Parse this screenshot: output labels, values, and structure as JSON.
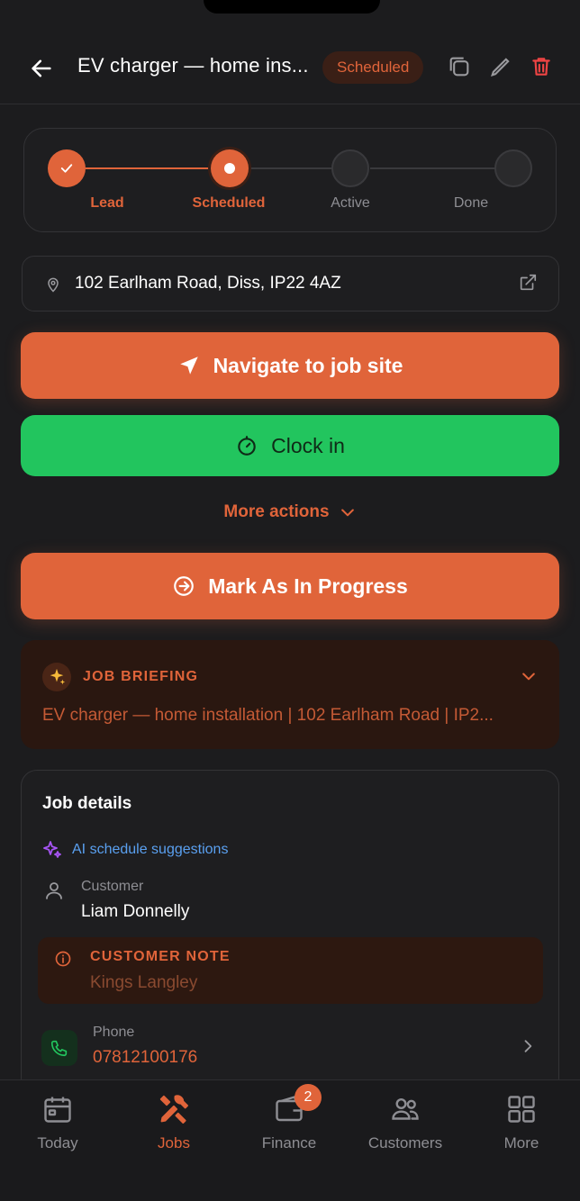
{
  "header": {
    "title": "EV charger — home ins...",
    "status": "Scheduled"
  },
  "progress": {
    "steps": [
      {
        "label": "Lead"
      },
      {
        "label": "Scheduled"
      },
      {
        "label": "Active"
      },
      {
        "label": "Done"
      }
    ]
  },
  "address": {
    "text": "102 Earlham Road, Diss, IP22 4AZ"
  },
  "actions": {
    "navigate_label": "Navigate to job site",
    "clock_in_label": "Clock in",
    "more_actions_label": "More actions",
    "mark_progress_label": "Mark As In Progress"
  },
  "briefing": {
    "title": "JOB BRIEFING",
    "text": "EV charger — home installation | 102 Earlham Road | IP2..."
  },
  "details": {
    "title": "Job details",
    "ai_link": "AI schedule suggestions",
    "customer_label": "Customer",
    "customer_name": "Liam Donnelly",
    "note_title": "CUSTOMER NOTE",
    "note_text": "Kings Langley",
    "phone_label": "Phone",
    "phone_number": "07812100176"
  },
  "tabbar": {
    "tabs": [
      {
        "label": "Today"
      },
      {
        "label": "Jobs"
      },
      {
        "label": "Finance",
        "badge": "2"
      },
      {
        "label": "Customers"
      },
      {
        "label": "More"
      }
    ]
  },
  "colors": {
    "accent": "#e0643a",
    "success": "#22c55e",
    "background": "#1c1c1e",
    "link": "#5aa0f0"
  }
}
